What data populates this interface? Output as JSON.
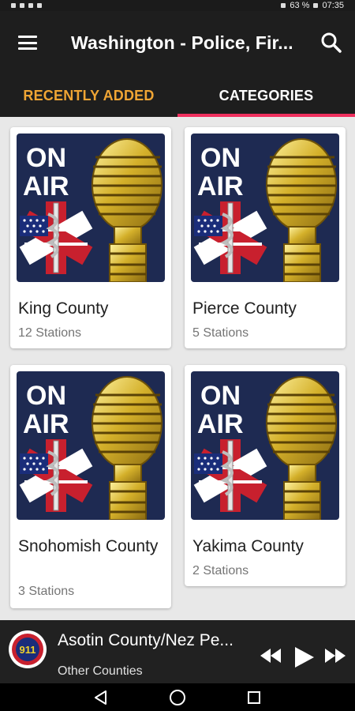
{
  "status_bar": {
    "battery": "63 %",
    "time": "07:35"
  },
  "app_bar": {
    "title": "Washington - Police, Fir..."
  },
  "tabs": [
    {
      "label": "RECENTLY ADDED",
      "active": false
    },
    {
      "label": "CATEGORIES",
      "active": true
    }
  ],
  "thumbnail": {
    "line1": "ON",
    "line2": "AIR"
  },
  "cards": [
    {
      "title": "King County",
      "subtitle": "12 Stations"
    },
    {
      "title": "Pierce County",
      "subtitle": "5 Stations"
    },
    {
      "title": "Snohomish County",
      "subtitle": "3 Stations"
    },
    {
      "title": "Yakima County",
      "subtitle": "2 Stations"
    }
  ],
  "player": {
    "logo_text": "911",
    "title": "Asotin County/Nez Pe...",
    "subtitle": "Other Counties"
  },
  "colors": {
    "accent_tab": "#f0a534",
    "indicator": "#ef2f5e",
    "appbar": "#1e1e1e",
    "thumb_bg": "#1e2a52"
  },
  "icons": {
    "menu": "hamburger-icon",
    "search": "search-icon",
    "rewind": "rewind-icon",
    "play": "play-icon",
    "fast_forward": "fast-forward-icon",
    "back": "nav-back-icon",
    "home": "nav-home-icon",
    "recents": "nav-recents-icon"
  }
}
